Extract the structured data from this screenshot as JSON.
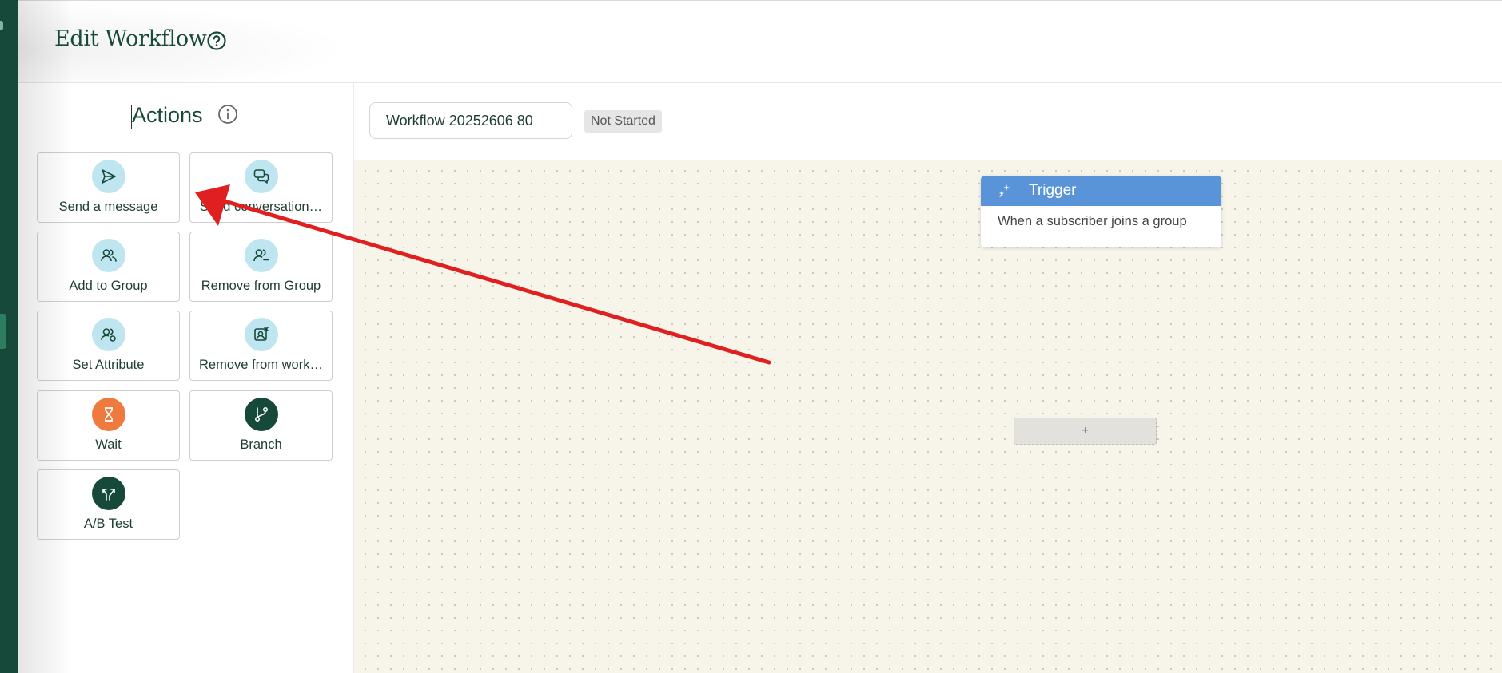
{
  "header": {
    "title": "Edit Workflow",
    "help_icon": "question-circle-icon"
  },
  "sidebar": {
    "title": "Actions",
    "info_icon": "info-circle-icon",
    "actions": [
      {
        "label": "Send a message",
        "icon": "send-icon"
      },
      {
        "label": "Send conversation…",
        "icon": "chat-bubbles-icon"
      },
      {
        "label": "Add to Group",
        "icon": "users-icon"
      },
      {
        "label": "Remove from Group",
        "icon": "user-minus-icon"
      },
      {
        "label": "Set Attribute",
        "icon": "user-attribute-icon"
      },
      {
        "label": "Remove from work…",
        "icon": "remove-workflow-icon"
      },
      {
        "label": "Wait",
        "icon": "hourglass-icon"
      },
      {
        "label": "Branch",
        "icon": "git-branch-icon"
      },
      {
        "label": "A/B Test",
        "icon": "split-arrows-icon"
      }
    ]
  },
  "workflow": {
    "name": "Workflow 20252606 80",
    "status": "Not Started"
  },
  "canvas": {
    "trigger": {
      "title": "Trigger",
      "description": "When a subscriber joins a group",
      "icon": "sparkle-icon"
    },
    "add_step_label": "+"
  },
  "colors": {
    "brand_dark": "#17493a",
    "trigger_header": "#5a94d8",
    "wait_icon_bg": "#ee7a3e",
    "action_icon_bg": "#bfe6f0",
    "canvas_bg": "#f7f4ea",
    "annotation_arrow": "#e02020"
  }
}
